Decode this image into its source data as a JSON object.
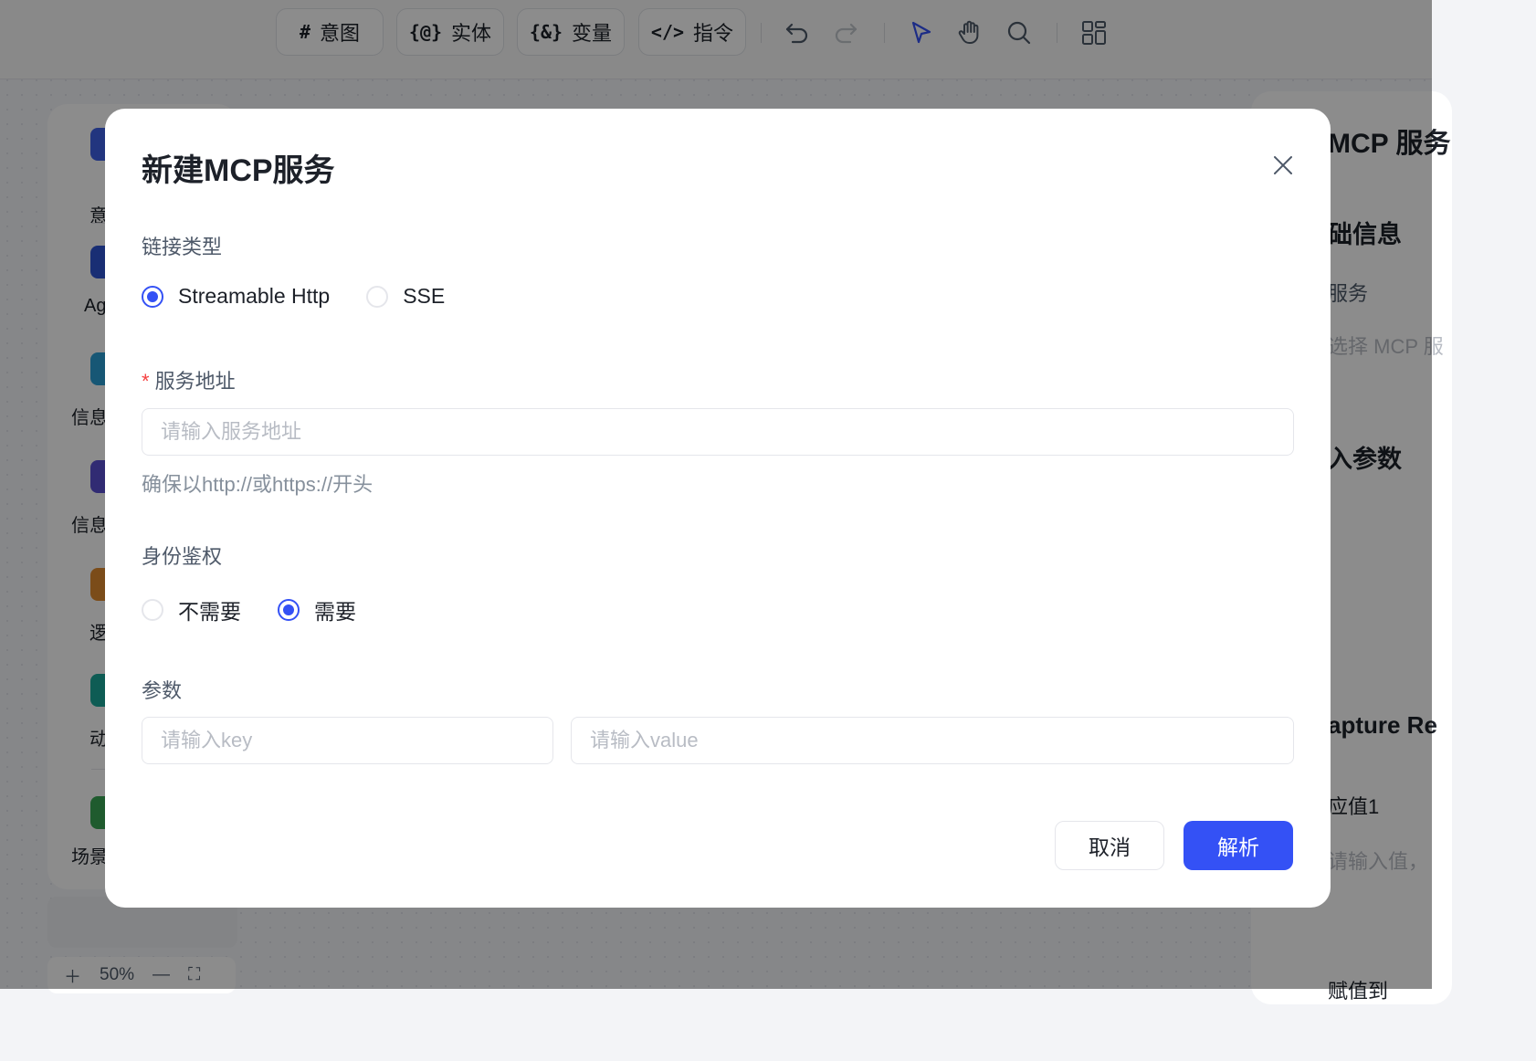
{
  "toolbar": {
    "intent": "意图",
    "entity": "实体",
    "variable": "变量",
    "command": "指令",
    "intent_icon": "#",
    "entity_icon": "{@}",
    "variable_icon": "{&}",
    "command_icon": "</>"
  },
  "sidebar": {
    "items": [
      {
        "label": "意",
        "color": "#3f62e8"
      },
      {
        "label": "Ag",
        "color": "#2f55d4"
      },
      {
        "label": "信息",
        "color": "#2a9fd6"
      },
      {
        "label": "信息",
        "color": "#5a4fd1"
      },
      {
        "label": "逻",
        "color": "#e08a2e"
      },
      {
        "label": "动",
        "color": "#1aa89a"
      },
      {
        "label": "场景",
        "color": "#3aa655"
      }
    ],
    "zoom": "50%"
  },
  "right_panel": {
    "title": "MCP 服务",
    "section_basic": "础信息",
    "service_label": "服务",
    "select_placeholder": "选择 MCP 服",
    "input_params": "入参数",
    "capture": "apture Re",
    "value1": "应值1",
    "value_placeholder": "请输入值，",
    "assign": "赋值到"
  },
  "modal": {
    "title": "新建MCP服务",
    "link_type_label": "链接类型",
    "link_types": [
      "Streamable Http",
      "SSE"
    ],
    "link_type_selected": 0,
    "service_url_label": "服务地址",
    "required_mark": "*",
    "service_url_placeholder": "请输入服务地址",
    "service_url_value": "",
    "service_url_hint": "确保以http://或https://开头",
    "auth_label": "身份鉴权",
    "auth_options": [
      "不需要",
      "需要"
    ],
    "auth_selected": 1,
    "params_label": "参数",
    "key_placeholder": "请输入key",
    "value_placeholder": "请输入value",
    "cancel_label": "取消",
    "parse_label": "解析"
  },
  "colors": {
    "primary": "#3451f5",
    "required": "#f53f3f",
    "overlay": "rgba(0,0,0,0.45)"
  }
}
